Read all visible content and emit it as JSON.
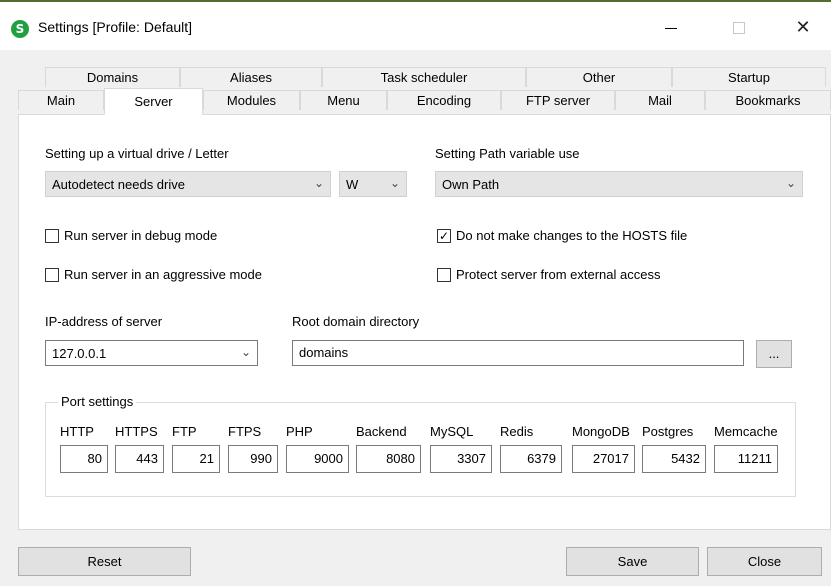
{
  "window": {
    "title": "Settings [Profile: Default]",
    "app_icon_letter": "S",
    "minimize_glyph": "—",
    "close_glyph": "✕"
  },
  "tabs_row1": [
    "Domains",
    "Aliases",
    "Task scheduler",
    "Other",
    "Startup"
  ],
  "tabs_row2": [
    "Main",
    "Server",
    "Modules",
    "Menu",
    "Encoding",
    "FTP server",
    "Mail",
    "Bookmarks"
  ],
  "active_tab": "Server",
  "server": {
    "virtual_drive_label": "Setting up a virtual drive / Letter",
    "virtual_drive_value": "Autodetect needs drive",
    "drive_letter_value": "W",
    "path_variable_label": "Setting Path variable use",
    "path_variable_value": "Own Path",
    "debug_mode_label": "Run server in debug mode",
    "debug_mode_checked": false,
    "aggressive_mode_label": "Run server in an aggressive mode",
    "aggressive_mode_checked": false,
    "no_hosts_label": "Do not make changes to the HOSTS file",
    "no_hosts_checked": true,
    "protect_label": "Protect server from external access",
    "protect_checked": false,
    "ip_label": "IP-address of server",
    "ip_value": "127.0.0.1",
    "root_dir_label": "Root domain directory",
    "root_dir_value": "domains",
    "browse_label": "..."
  },
  "ports": {
    "group_title": "Port settings",
    "items": [
      {
        "label": "HTTP",
        "value": "80"
      },
      {
        "label": "HTTPS",
        "value": "443"
      },
      {
        "label": "FTP",
        "value": "21"
      },
      {
        "label": "FTPS",
        "value": "990"
      },
      {
        "label": "PHP",
        "value": "9000"
      },
      {
        "label": "Backend",
        "value": "8080"
      },
      {
        "label": "MySQL",
        "value": "3307"
      },
      {
        "label": "Redis",
        "value": "6379"
      },
      {
        "label": "MongoDB",
        "value": "27017"
      },
      {
        "label": "Postgres",
        "value": "5432"
      },
      {
        "label": "Memcache",
        "value": "11211"
      }
    ]
  },
  "footer": {
    "reset_label": "Reset",
    "save_label": "Save",
    "close_label": "Close"
  },
  "icons": {
    "chevron": "chevron-down-icon",
    "check": "checkmark-icon"
  },
  "colors": {
    "app_icon": "#20a040",
    "panel_bg": "#ffffff",
    "window_bg": "#f0f0f0"
  }
}
